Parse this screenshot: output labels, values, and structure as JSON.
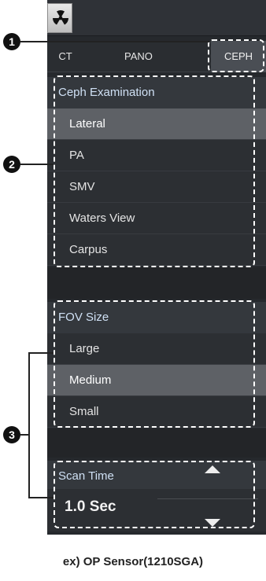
{
  "tabs": {
    "ct": "CT",
    "pano": "PANO",
    "ceph": "CEPH"
  },
  "ceph_exam": {
    "header": "Ceph Examination",
    "items": [
      "Lateral",
      "PA",
      "SMV",
      "Waters View",
      "Carpus"
    ],
    "selected": "Lateral"
  },
  "fov": {
    "header": "FOV Size",
    "items": [
      "Large",
      "Medium",
      "Small"
    ],
    "selected": "Medium"
  },
  "scan": {
    "header": "Scan Time",
    "value": "1.0 Sec"
  },
  "callouts": {
    "one": "1",
    "two": "2",
    "three": "3"
  },
  "caption": "ex) OP Sensor(1210SGA)",
  "icons": {
    "logo": "radiation-icon",
    "up": "arrow-up-icon",
    "down": "arrow-down-icon"
  }
}
